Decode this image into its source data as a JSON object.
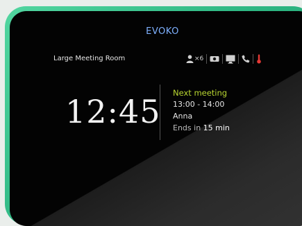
{
  "brand": "EVOKO",
  "room_name": "Large Meeting Room",
  "amenities": {
    "capacity_icon": "person-icon",
    "capacity_count": "×6",
    "items": [
      "camera-icon",
      "display-icon",
      "phone-icon",
      "thermometer-icon"
    ]
  },
  "clock": "12:45",
  "next_meeting": {
    "title": "Next meeting",
    "time": "13:00 - 14:00",
    "organizer": "Anna",
    "ends_prefix": "Ends in",
    "ends_value": "15 min"
  },
  "colors": {
    "bezel_accent": "#2fb884",
    "brand": "#7fb1ff",
    "next_meeting_title": "#b9d631",
    "thermometer": "#e53935"
  }
}
